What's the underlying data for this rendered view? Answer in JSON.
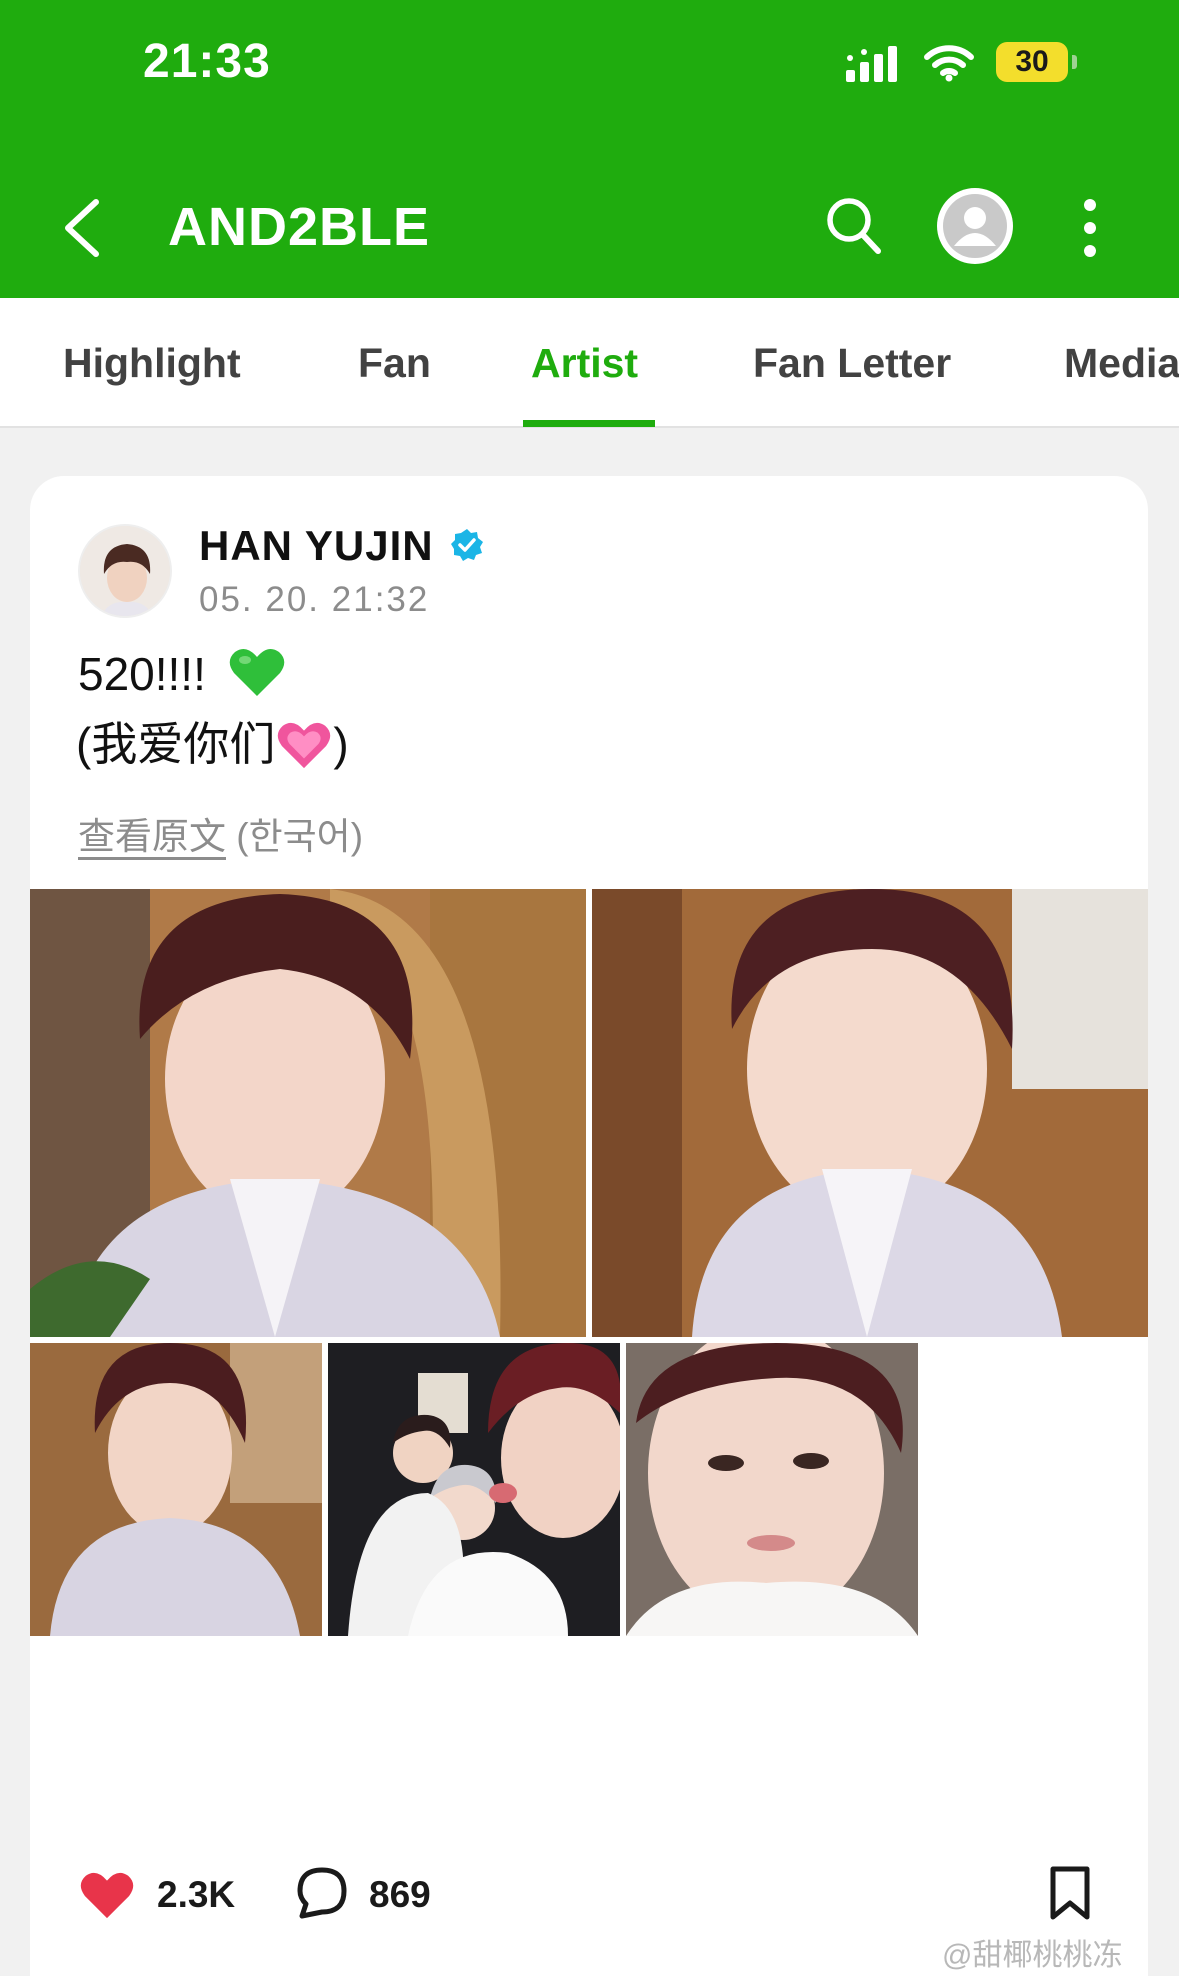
{
  "status_bar": {
    "time": "21:33",
    "battery": "30"
  },
  "header": {
    "title": "AND2BLE"
  },
  "tabs": [
    {
      "label": "Highlight"
    },
    {
      "label": "Fan"
    },
    {
      "label": "Artist",
      "active": true
    },
    {
      "label": "Fan Letter"
    },
    {
      "label": "Media"
    }
  ],
  "post": {
    "author": "HAN YUJIN",
    "date": "05. 20. 21:32",
    "line1": "520!!!!",
    "line2_open": "(我爱你们",
    "line2_close": ")",
    "translation_link": "查看原文",
    "translation_lang": "(한국어)",
    "likes": "2.3K",
    "comments": "869"
  },
  "watermark": "@甜椰桃桃冻",
  "colors": {
    "brand_green": "#1fac0e",
    "like_red": "#e8344a",
    "verified_blue": "#1bb5e6"
  }
}
